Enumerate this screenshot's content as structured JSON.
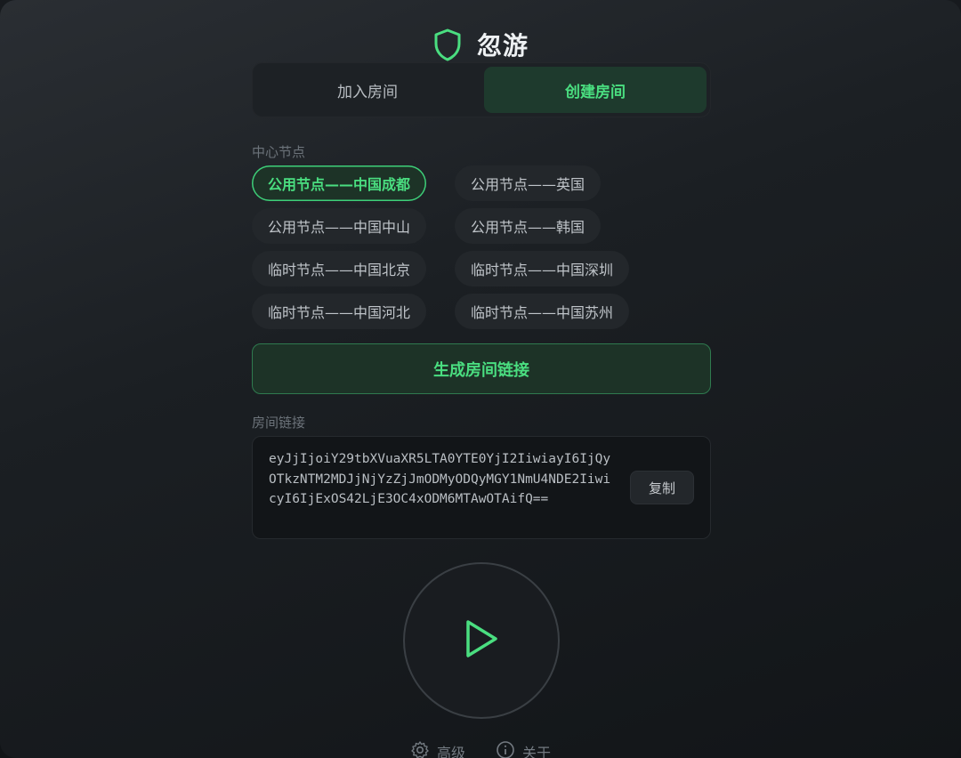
{
  "app": {
    "title": "忽游"
  },
  "tabs": [
    {
      "label": "加入房间",
      "active": false
    },
    {
      "label": "创建房间",
      "active": true
    }
  ],
  "nodes_section": {
    "label": "中心节点",
    "items": [
      {
        "label": "公用节点——中国成都",
        "selected": true
      },
      {
        "label": "公用节点——英国",
        "selected": false
      },
      {
        "label": "公用节点——中国中山",
        "selected": false
      },
      {
        "label": "公用节点——韩国",
        "selected": false
      },
      {
        "label": "临时节点——中国北京",
        "selected": false
      },
      {
        "label": "临时节点——中国深圳",
        "selected": false
      },
      {
        "label": "临时节点——中国河北",
        "selected": false
      },
      {
        "label": "临时节点——中国苏州",
        "selected": false
      }
    ]
  },
  "generate_button": {
    "label": "生成房间链接"
  },
  "room_link": {
    "label": "房间链接",
    "value": "eyJjIjoiY29tbXVuaXR5LTA0YTE0YjI2IiwiayI6IjQyOTkzNTM2MDJjNjYzZjJmODMyODQyMGY1NmU4NDE2IiwicyI6IjExOS42LjE3OC4xODM6MTAwOTAifQ==",
    "copy_label": "复制"
  },
  "play_button": {
    "icon": "play-icon"
  },
  "footer": {
    "advanced_label": "高级",
    "about_label": "关于"
  },
  "colors": {
    "accent": "#4ade80",
    "accent_bg": "#1d3327",
    "background": "#1b1f23"
  }
}
